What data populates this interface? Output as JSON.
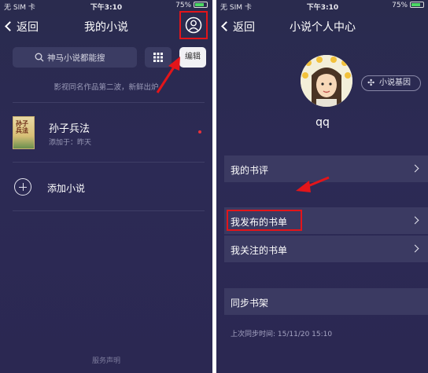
{
  "status_bar": {
    "carrier": "无 SIM 卡",
    "time": "下午3:10",
    "battery": "75%"
  },
  "left_screen": {
    "back_label": "返回",
    "title": "我的小说",
    "search_placeholder": "神马小说都能搜",
    "edit_label": "编辑",
    "ticker_text": "影视同名作品第二波，新鲜出炉",
    "book": {
      "title": "孙子兵法",
      "added": "添加于：昨天",
      "cover_text": "孙子兵法"
    },
    "add_label": "添加小说",
    "footer": "服务声明"
  },
  "right_screen": {
    "back_label": "返回",
    "title": "小说个人中心",
    "gene_label": "小说基因",
    "username": "qq",
    "menu": [
      {
        "label": "我的书评"
      },
      {
        "label": "我发布的书单"
      },
      {
        "label": "我关注的书单"
      },
      {
        "label": "同步书架"
      }
    ],
    "sync_time": "上次同步时间: 15/11/20 15:10"
  },
  "accent_color": "#e3151a",
  "icons": [
    "back-chevron-icon",
    "profile-icon",
    "search-icon",
    "grid-icon",
    "plus-icon",
    "gene-icon",
    "chevron-right-icon"
  ]
}
